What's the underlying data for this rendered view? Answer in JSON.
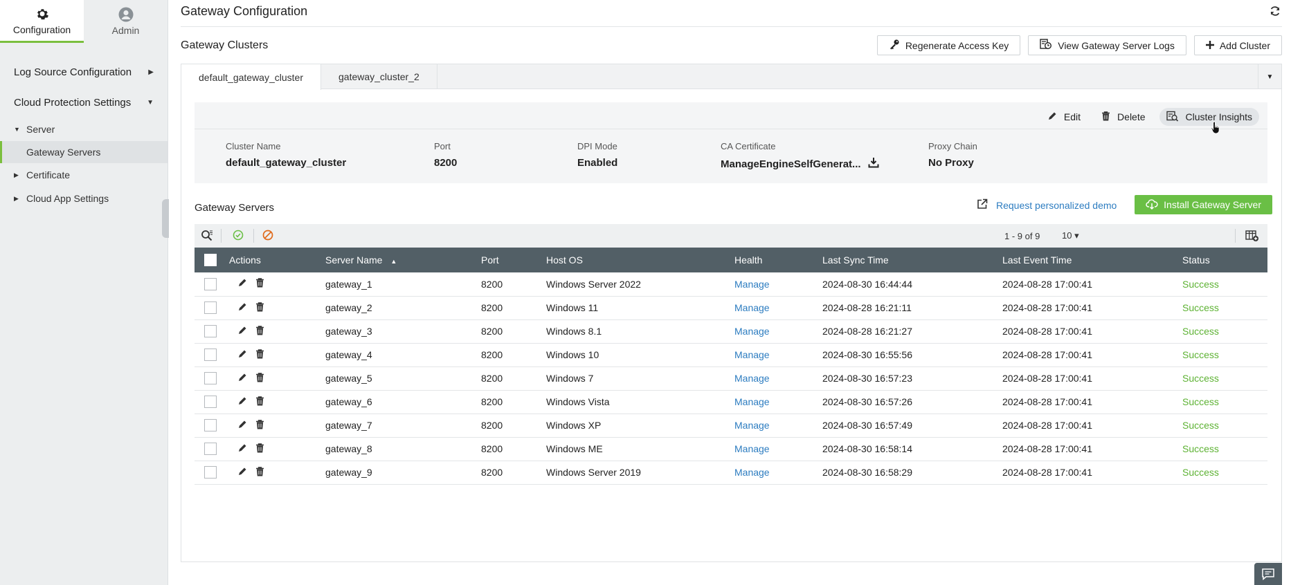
{
  "top_tabs": [
    {
      "label": "Configuration",
      "icon": "gear-icon",
      "active": true
    },
    {
      "label": "Admin",
      "icon": "user-icon",
      "active": false
    }
  ],
  "sidebar": {
    "log_source": "Log Source Configuration",
    "cloud_protection": "Cloud Protection Settings",
    "server": "Server",
    "gateway_servers": "Gateway Servers",
    "certificate": "Certificate",
    "cloud_app_settings": "Cloud App Settings"
  },
  "page_title": "Gateway Configuration",
  "section_title": "Gateway Clusters",
  "buttons": {
    "regenerate": "Regenerate Access Key",
    "view_logs": "View Gateway Server Logs",
    "add_cluster": "Add Cluster"
  },
  "cluster_tabs": [
    "default_gateway_cluster",
    "gateway_cluster_2"
  ],
  "detail_actions": {
    "edit": "Edit",
    "delete": "Delete",
    "insights": "Cluster Insights"
  },
  "cluster": {
    "name_label": "Cluster Name",
    "name": "default_gateway_cluster",
    "port_label": "Port",
    "port": "8200",
    "dpi_label": "DPI Mode",
    "dpi": "Enabled",
    "ca_label": "CA Certificate",
    "ca": "ManageEngineSelfGenerat...",
    "proxy_label": "Proxy Chain",
    "proxy": "No Proxy"
  },
  "gateway_servers_title": "Gateway Servers",
  "demo_link": "Request personalized demo",
  "install_button": "Install Gateway Server",
  "pager": "1 - 9 of 9",
  "per_page": "10",
  "columns": [
    "Actions",
    "Server Name",
    "Port",
    "Host OS",
    "Health",
    "Last Sync Time",
    "Last Event Time",
    "Status"
  ],
  "rows": [
    {
      "name": "gateway_1",
      "port": "8200",
      "os": "Windows Server 2022",
      "health": "Manage",
      "sync": "2024-08-30 16:44:44",
      "event": "2024-08-28 17:00:41",
      "status": "Success"
    },
    {
      "name": "gateway_2",
      "port": "8200",
      "os": "Windows 11",
      "health": "Manage",
      "sync": "2024-08-28 16:21:11",
      "event": "2024-08-28 17:00:41",
      "status": "Success"
    },
    {
      "name": "gateway_3",
      "port": "8200",
      "os": "Windows 8.1",
      "health": "Manage",
      "sync": "2024-08-28 16:21:27",
      "event": "2024-08-28 17:00:41",
      "status": "Success"
    },
    {
      "name": "gateway_4",
      "port": "8200",
      "os": "Windows 10",
      "health": "Manage",
      "sync": "2024-08-30 16:55:56",
      "event": "2024-08-28 17:00:41",
      "status": "Success"
    },
    {
      "name": "gateway_5",
      "port": "8200",
      "os": "Windows 7",
      "health": "Manage",
      "sync": "2024-08-30 16:57:23",
      "event": "2024-08-28 17:00:41",
      "status": "Success"
    },
    {
      "name": "gateway_6",
      "port": "8200",
      "os": "Windows Vista",
      "health": "Manage",
      "sync": "2024-08-30 16:57:26",
      "event": "2024-08-28 17:00:41",
      "status": "Success"
    },
    {
      "name": "gateway_7",
      "port": "8200",
      "os": "Windows XP",
      "health": "Manage",
      "sync": "2024-08-30 16:57:49",
      "event": "2024-08-28 17:00:41",
      "status": "Success"
    },
    {
      "name": "gateway_8",
      "port": "8200",
      "os": "Windows ME",
      "health": "Manage",
      "sync": "2024-08-30 16:58:14",
      "event": "2024-08-28 17:00:41",
      "status": "Success"
    },
    {
      "name": "gateway_9",
      "port": "8200",
      "os": "Windows Server 2019",
      "health": "Manage",
      "sync": "2024-08-30 16:58:29",
      "event": "2024-08-28 17:00:41",
      "status": "Success"
    }
  ],
  "colors": {
    "accent_green": "#7bbf3e",
    "install_green": "#6abf45",
    "link_blue": "#2c7cc0",
    "header_gray": "#525f66",
    "success": "#5db233"
  }
}
